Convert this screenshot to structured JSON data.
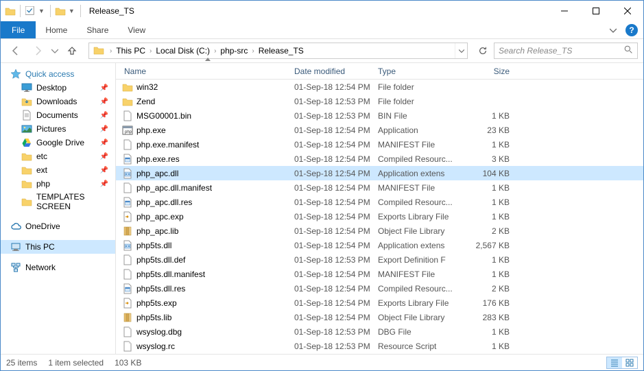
{
  "window": {
    "title": "Release_TS"
  },
  "ribbon": {
    "file": "File",
    "tabs": [
      "Home",
      "Share",
      "View"
    ]
  },
  "breadcrumb": {
    "items": [
      "This PC",
      "Local Disk (C:)",
      "php-src",
      "Release_TS"
    ]
  },
  "search": {
    "placeholder": "Search Release_TS"
  },
  "sidebar": {
    "quick_access": "Quick access",
    "qa_items": [
      {
        "label": "Desktop",
        "pinned": true,
        "icon": "desktop"
      },
      {
        "label": "Downloads",
        "pinned": true,
        "icon": "downloads"
      },
      {
        "label": "Documents",
        "pinned": true,
        "icon": "documents"
      },
      {
        "label": "Pictures",
        "pinned": true,
        "icon": "pictures"
      },
      {
        "label": "Google Drive",
        "pinned": true,
        "icon": "gdrive"
      },
      {
        "label": "etc",
        "pinned": true,
        "icon": "folder"
      },
      {
        "label": "ext",
        "pinned": true,
        "icon": "folder"
      },
      {
        "label": "php",
        "pinned": true,
        "icon": "folder"
      },
      {
        "label": "TEMPLATES SCREEN",
        "pinned": false,
        "icon": "folder"
      }
    ],
    "onedrive": "OneDrive",
    "thispc": "This PC",
    "network": "Network"
  },
  "columns": {
    "name": "Name",
    "date": "Date modified",
    "type": "Type",
    "size": "Size"
  },
  "files": [
    {
      "name": "win32",
      "date": "01-Sep-18 12:54 PM",
      "type": "File folder",
      "size": "",
      "icon": "folder",
      "selected": false
    },
    {
      "name": "Zend",
      "date": "01-Sep-18 12:53 PM",
      "type": "File folder",
      "size": "",
      "icon": "folder",
      "selected": false
    },
    {
      "name": "MSG00001.bin",
      "date": "01-Sep-18 12:53 PM",
      "type": "BIN File",
      "size": "1 KB",
      "icon": "file",
      "selected": false
    },
    {
      "name": "php.exe",
      "date": "01-Sep-18 12:54 PM",
      "type": "Application",
      "size": "23 KB",
      "icon": "exe",
      "selected": false
    },
    {
      "name": "php.exe.manifest",
      "date": "01-Sep-18 12:54 PM",
      "type": "MANIFEST File",
      "size": "1 KB",
      "icon": "file",
      "selected": false
    },
    {
      "name": "php.exe.res",
      "date": "01-Sep-18 12:54 PM",
      "type": "Compiled Resourc...",
      "size": "3 KB",
      "icon": "res",
      "selected": false
    },
    {
      "name": "php_apc.dll",
      "date": "01-Sep-18 12:54 PM",
      "type": "Application extens",
      "size": "104 KB",
      "icon": "dll",
      "selected": true
    },
    {
      "name": "php_apc.dll.manifest",
      "date": "01-Sep-18 12:54 PM",
      "type": "MANIFEST File",
      "size": "1 KB",
      "icon": "file",
      "selected": false
    },
    {
      "name": "php_apc.dll.res",
      "date": "01-Sep-18 12:54 PM",
      "type": "Compiled Resourc...",
      "size": "1 KB",
      "icon": "res",
      "selected": false
    },
    {
      "name": "php_apc.exp",
      "date": "01-Sep-18 12:54 PM",
      "type": "Exports Library File",
      "size": "1 KB",
      "icon": "exp",
      "selected": false
    },
    {
      "name": "php_apc.lib",
      "date": "01-Sep-18 12:54 PM",
      "type": "Object File Library",
      "size": "2 KB",
      "icon": "lib",
      "selected": false
    },
    {
      "name": "php5ts.dll",
      "date": "01-Sep-18 12:54 PM",
      "type": "Application extens",
      "size": "2,567 KB",
      "icon": "dll",
      "selected": false
    },
    {
      "name": "php5ts.dll.def",
      "date": "01-Sep-18 12:53 PM",
      "type": "Export Definition F",
      "size": "1 KB",
      "icon": "file",
      "selected": false
    },
    {
      "name": "php5ts.dll.manifest",
      "date": "01-Sep-18 12:54 PM",
      "type": "MANIFEST File",
      "size": "1 KB",
      "icon": "file",
      "selected": false
    },
    {
      "name": "php5ts.dll.res",
      "date": "01-Sep-18 12:54 PM",
      "type": "Compiled Resourc...",
      "size": "2 KB",
      "icon": "res",
      "selected": false
    },
    {
      "name": "php5ts.exp",
      "date": "01-Sep-18 12:54 PM",
      "type": "Exports Library File",
      "size": "176 KB",
      "icon": "exp",
      "selected": false
    },
    {
      "name": "php5ts.lib",
      "date": "01-Sep-18 12:54 PM",
      "type": "Object File Library",
      "size": "283 KB",
      "icon": "lib",
      "selected": false
    },
    {
      "name": "wsyslog.dbg",
      "date": "01-Sep-18 12:53 PM",
      "type": "DBG File",
      "size": "1 KB",
      "icon": "file",
      "selected": false
    },
    {
      "name": "wsyslog.rc",
      "date": "01-Sep-18 12:53 PM",
      "type": "Resource Script",
      "size": "1 KB",
      "icon": "file",
      "selected": false
    }
  ],
  "status": {
    "count": "25 items",
    "selection": "1 item selected",
    "size": "103 KB"
  }
}
